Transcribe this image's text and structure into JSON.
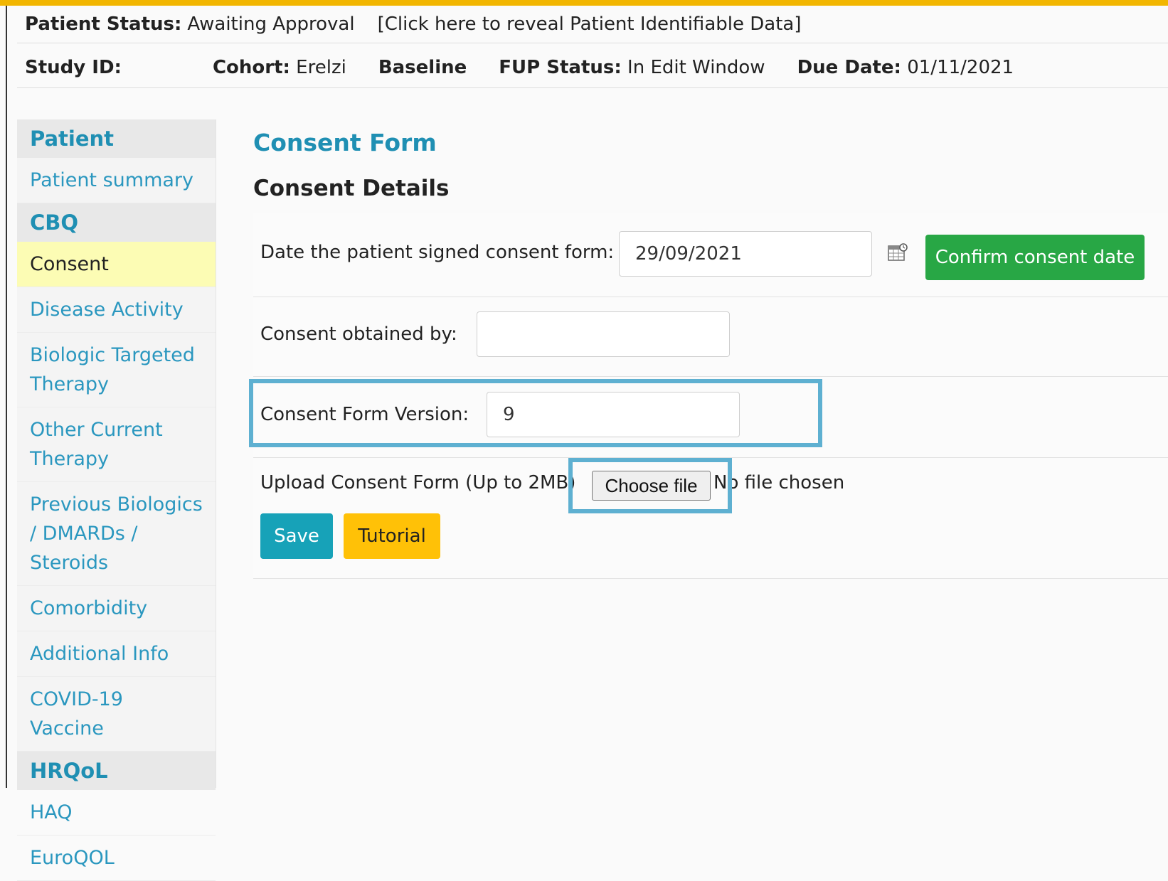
{
  "header": {
    "patient_status_label": "Patient Status:",
    "patient_status_value": "Awaiting Approval",
    "reveal_link": "[Click here to reveal Patient Identifiable Data]",
    "study_id_label": "Study ID:",
    "study_id_value": "",
    "cohort_label": "Cohort:",
    "cohort_value": "Erelzi",
    "visit": "Baseline",
    "fup_status_label": "FUP Status:",
    "fup_status_value": "In Edit Window",
    "due_date_label": "Due Date:",
    "due_date_value": "01/11/2021"
  },
  "sidebar": {
    "patient_header": "Patient",
    "patient_items": [
      "Patient summary"
    ],
    "cbq_header": "CBQ",
    "cbq_items": [
      "Consent",
      "Disease Activity",
      "Biologic Targeted Therapy",
      "Other Current Therapy",
      "Previous Biologics / DMARDs / Steroids",
      "Comorbidity",
      "Additional Info",
      "COVID-19 Vaccine"
    ],
    "hrqol_header": "HRQoL",
    "hrqol_items": [
      "HAQ",
      "EuroQOL"
    ]
  },
  "main": {
    "form_title": "Consent Form",
    "section_title": "Consent Details",
    "consent_date_label": "Date the patient signed consent form:",
    "consent_date_value": "29/09/2021",
    "confirm_button": "Confirm consent date",
    "obtained_by_label": "Consent obtained by:",
    "obtained_by_value": "",
    "version_label": "Consent Form Version:",
    "version_value": "9",
    "upload_label": "Upload Consent Form (Up to 2MB)",
    "choose_file": "Choose file",
    "no_file": "No file chosen",
    "save_button": "Save",
    "tutorial_button": "Tutorial"
  },
  "colors": {
    "accent": "#1f8fb3",
    "green": "#28a745",
    "save": "#17a2b8",
    "tutorial": "#ffc107",
    "active_row": "#fcfcb4",
    "highlight": "#5eb0d1",
    "topbar": "#f2b600"
  }
}
